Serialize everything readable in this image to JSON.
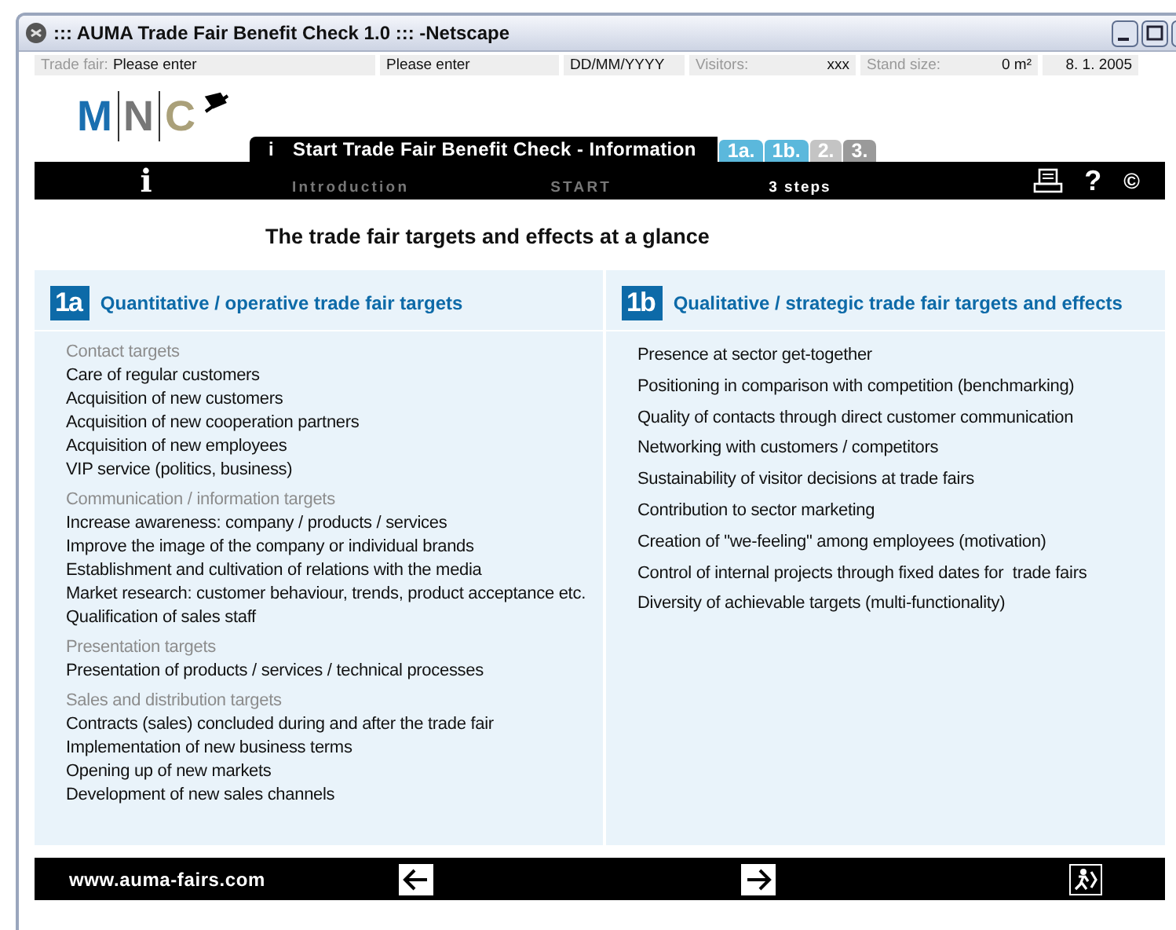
{
  "window": {
    "title": "::: AUMA Trade Fair Benefit Check 1.0 ::: -Netscape"
  },
  "info_bar": [
    {
      "label": "Trade fair:",
      "value": "Please enter"
    },
    {
      "value": "Please enter"
    },
    {
      "value": "DD/MM/YYYY"
    },
    {
      "label": "Visitors:",
      "value": "xxx"
    },
    {
      "label": "Stand size:",
      "value": "0 m²"
    },
    {
      "value": "8. 1. 2005"
    }
  ],
  "logo": {
    "letters": [
      "M",
      "N",
      "C"
    ]
  },
  "header_tab": {
    "icon_text": "i",
    "title": "Start Trade Fair Benefit Check - Information"
  },
  "step_tabs": [
    {
      "label": "1a.",
      "color": "#5bb8dc"
    },
    {
      "label": "1b.",
      "color": "#5bb8dc"
    },
    {
      "label": "2.",
      "color": "#c4c4c4"
    },
    {
      "label": "3.",
      "color": "#9a9a9a"
    }
  ],
  "nav": {
    "icon_text": "i",
    "items": [
      {
        "label": "Introduction",
        "selected": false
      },
      {
        "label": "START",
        "selected": false
      },
      {
        "label": "3 steps",
        "selected": true
      }
    ],
    "tools": [
      {
        "kind": "print"
      },
      {
        "kind": "text",
        "text": "?"
      },
      {
        "kind": "text",
        "text": "©"
      }
    ]
  },
  "heading": "The trade fair targets and effects at a glance",
  "panels": [
    {
      "badge": "1a",
      "title": "Quantitative / operative trade fair targets",
      "groups": [
        {
          "heading": "Contact targets",
          "items": [
            "Care of regular customers",
            "Acquisition of new customers",
            "Acquisition of new cooperation partners",
            "Acquisition of new employees",
            "VIP service (politics, business)"
          ]
        },
        {
          "heading": "Communication / information targets",
          "items": [
            "Increase awareness: company / products / services",
            "Improve the image of the company or individual brands",
            "Establishment and cultivation of relations with the media",
            "Market research: customer behaviour, trends, product acceptance etc.",
            "Qualification of sales staff"
          ]
        },
        {
          "heading": "Presentation targets",
          "items": [
            "Presentation of products / services / technical processes"
          ]
        },
        {
          "heading": "Sales and distribution targets",
          "items": [
            "Contracts (sales) concluded during and after the trade fair",
            "Implementation of new business terms",
            "Opening up of new markets",
            "Development of new sales channels"
          ]
        }
      ]
    },
    {
      "badge": "1b",
      "title": "Qualitative / strategic trade fair targets and effects",
      "groups": [
        {
          "items": [
            "Presence at sector get-together",
            "Positioning in comparison with competition (benchmarking)",
            "Quality of contacts through direct customer communication",
            "Networking with customers / competitors",
            "Sustainability of visitor decisions at trade fairs",
            "Contribution to sector marketing",
            "Creation of \"we-feeling\" among employees (motivation)",
            "Control of internal projects through fixed dates for  trade fairs",
            "Diversity of achievable targets (multi-functionality)"
          ]
        }
      ]
    }
  ],
  "footer": {
    "url": "www.auma-fairs.com"
  }
}
